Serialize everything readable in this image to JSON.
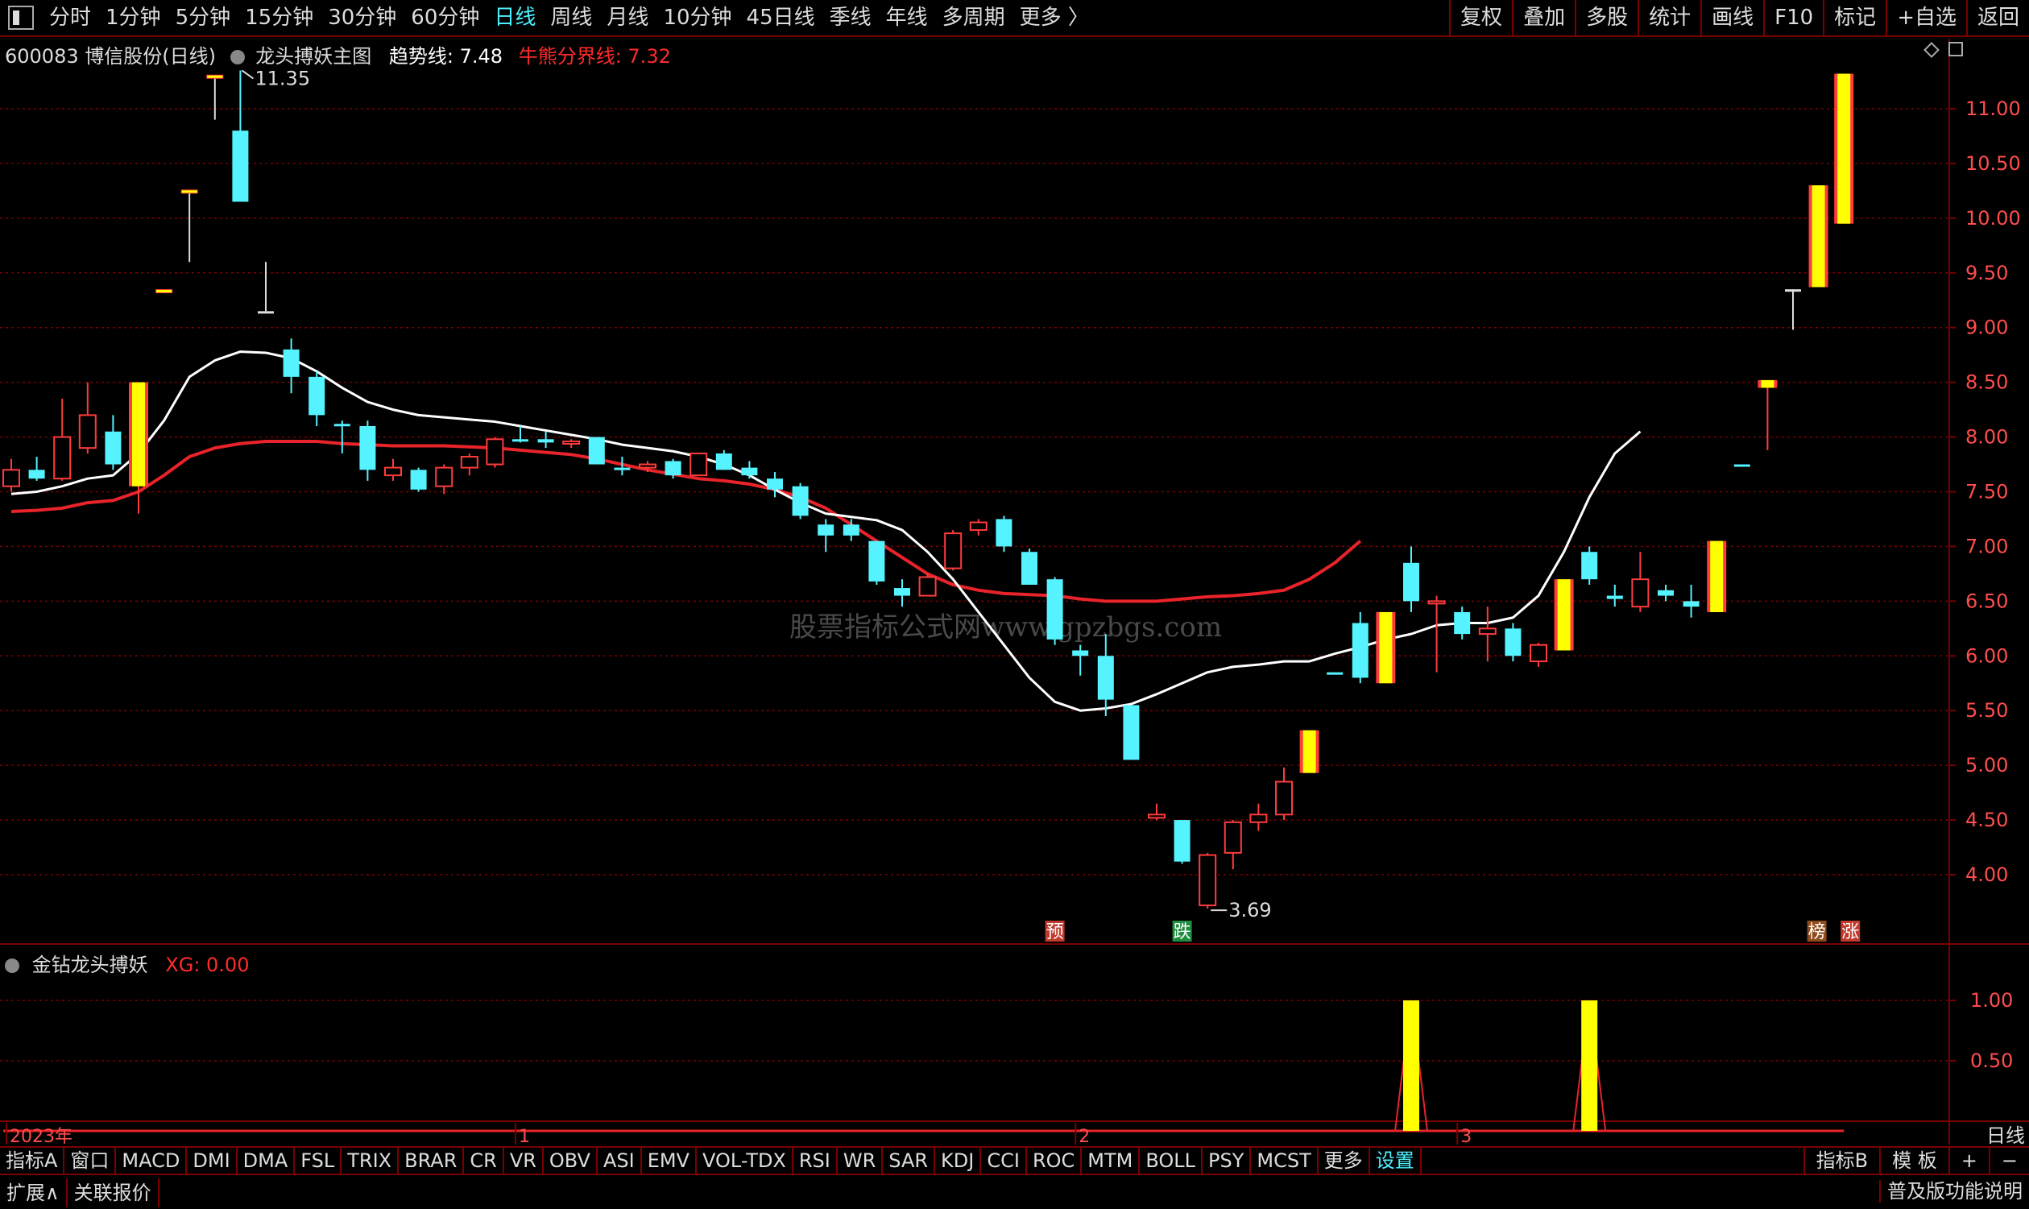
{
  "toolbar": {
    "timeframes": [
      "分时",
      "1分钟",
      "5分钟",
      "15分钟",
      "30分钟",
      "60分钟",
      "日线",
      "周线",
      "月线",
      "10分钟",
      "45日线",
      "季线",
      "年线",
      "多周期",
      "更多 〉"
    ],
    "active_timeframe": "日线",
    "right_buttons": [
      "复权",
      "叠加",
      "多股",
      "统计",
      "画线",
      "F10",
      "标记",
      "+自选",
      "返回"
    ]
  },
  "stock": {
    "code_name": "600083 博信股份(日线)",
    "indicator_title": "龙头搏妖主图",
    "trend_label": "趋势线: 7.48",
    "bull_label": "牛熊分界线: 7.32"
  },
  "sub_indicator": {
    "name": "金钻龙头搏妖",
    "xg_label": "XG: 0.00"
  },
  "watermark": "股票指标公式网www.gpzbgs.com",
  "annotations": {
    "high": "11.35",
    "low": "3.69",
    "yu": "预",
    "die": "跌",
    "bang": "榜",
    "zhang": "涨"
  },
  "x_axis": {
    "labels": [
      "2023年",
      "1",
      "2",
      "3"
    ],
    "period": "日线"
  },
  "main_chart": {
    "y_ticks": [
      "11.00",
      "10.50",
      "10.00",
      "9.50",
      "9.00",
      "8.50",
      "8.00",
      "7.50",
      "7.00",
      "6.50",
      "6.00",
      "5.50",
      "5.00",
      "4.50",
      "4.00"
    ],
    "y_tick_values": [
      11.0,
      10.5,
      10.0,
      9.5,
      9.0,
      8.5,
      8.0,
      7.5,
      7.0,
      6.5,
      6.0,
      5.5,
      5.0,
      4.5,
      4.0
    ],
    "candles": [
      {
        "o": 7.55,
        "h": 7.8,
        "l": 7.5,
        "c": 7.7,
        "k": "up"
      },
      {
        "o": 7.7,
        "h": 7.82,
        "l": 7.6,
        "c": 7.62,
        "k": "down"
      },
      {
        "o": 7.62,
        "h": 8.35,
        "l": 7.6,
        "c": 8.0,
        "k": "up"
      },
      {
        "o": 7.9,
        "h": 8.5,
        "l": 7.85,
        "c": 8.2,
        "k": "up"
      },
      {
        "o": 8.05,
        "h": 8.2,
        "l": 7.7,
        "c": 7.75,
        "k": "down"
      },
      {
        "o": 7.55,
        "h": 8.5,
        "l": 7.3,
        "c": 8.5,
        "k": "long"
      },
      {
        "o": 9.34,
        "h": 9.34,
        "l": 9.34,
        "c": 9.34,
        "k": "long_line"
      },
      {
        "o": 10.25,
        "h": 10.25,
        "l": 9.6,
        "c": 10.25,
        "k": "long_line"
      },
      {
        "o": 11.3,
        "h": 11.3,
        "l": 10.9,
        "c": 11.3,
        "k": "long_line"
      },
      {
        "o": 10.8,
        "h": 11.35,
        "l": 10.15,
        "c": 10.15,
        "k": "down"
      },
      {
        "o": 9.15,
        "h": 9.6,
        "l": 9.15,
        "c": 9.15,
        "k": "up_line"
      },
      {
        "o": 8.8,
        "h": 8.9,
        "l": 8.4,
        "c": 8.55,
        "k": "down"
      },
      {
        "o": 8.55,
        "h": 8.6,
        "l": 8.1,
        "c": 8.2,
        "k": "down"
      },
      {
        "o": 8.12,
        "h": 8.15,
        "l": 7.85,
        "c": 8.1,
        "k": "down"
      },
      {
        "o": 8.1,
        "h": 8.15,
        "l": 7.6,
        "c": 7.7,
        "k": "down"
      },
      {
        "o": 7.65,
        "h": 7.8,
        "l": 7.6,
        "c": 7.72,
        "k": "up"
      },
      {
        "o": 7.7,
        "h": 7.72,
        "l": 7.5,
        "c": 7.52,
        "k": "down"
      },
      {
        "o": 7.55,
        "h": 7.75,
        "l": 7.48,
        "c": 7.72,
        "k": "up"
      },
      {
        "o": 7.72,
        "h": 7.85,
        "l": 7.65,
        "c": 7.82,
        "k": "up"
      },
      {
        "o": 7.75,
        "h": 8.0,
        "l": 7.72,
        "c": 7.98,
        "k": "up"
      },
      {
        "o": 7.98,
        "h": 8.1,
        "l": 7.95,
        "c": 7.98,
        "k": "down"
      },
      {
        "o": 7.98,
        "h": 8.05,
        "l": 7.9,
        "c": 7.95,
        "k": "down"
      },
      {
        "o": 7.95,
        "h": 7.98,
        "l": 7.9,
        "c": 7.96,
        "k": "up"
      },
      {
        "o": 8.0,
        "h": 8.0,
        "l": 7.75,
        "c": 7.75,
        "k": "down"
      },
      {
        "o": 7.72,
        "h": 7.82,
        "l": 7.65,
        "c": 7.7,
        "k": "down"
      },
      {
        "o": 7.72,
        "h": 7.78,
        "l": 7.68,
        "c": 7.75,
        "k": "up"
      },
      {
        "o": 7.78,
        "h": 7.8,
        "l": 7.62,
        "c": 7.65,
        "k": "down"
      },
      {
        "o": 7.65,
        "h": 7.85,
        "l": 7.65,
        "c": 7.85,
        "k": "up"
      },
      {
        "o": 7.85,
        "h": 7.88,
        "l": 7.7,
        "c": 7.7,
        "k": "down"
      },
      {
        "o": 7.72,
        "h": 7.78,
        "l": 7.62,
        "c": 7.65,
        "k": "down"
      },
      {
        "o": 7.62,
        "h": 7.68,
        "l": 7.45,
        "c": 7.52,
        "k": "down"
      },
      {
        "o": 7.55,
        "h": 7.58,
        "l": 7.25,
        "c": 7.28,
        "k": "down"
      },
      {
        "o": 7.2,
        "h": 7.25,
        "l": 6.95,
        "c": 7.1,
        "k": "down"
      },
      {
        "o": 7.2,
        "h": 7.25,
        "l": 7.05,
        "c": 7.1,
        "k": "down"
      },
      {
        "o": 7.05,
        "h": 7.05,
        "l": 6.65,
        "c": 6.68,
        "k": "down"
      },
      {
        "o": 6.62,
        "h": 6.7,
        "l": 6.45,
        "c": 6.55,
        "k": "down"
      },
      {
        "o": 6.55,
        "h": 6.75,
        "l": 6.55,
        "c": 6.72,
        "k": "up"
      },
      {
        "o": 6.8,
        "h": 7.15,
        "l": 6.78,
        "c": 7.12,
        "k": "up"
      },
      {
        "o": 7.15,
        "h": 7.25,
        "l": 7.1,
        "c": 7.22,
        "k": "up"
      },
      {
        "o": 7.25,
        "h": 7.28,
        "l": 6.95,
        "c": 7.0,
        "k": "down"
      },
      {
        "o": 6.95,
        "h": 6.98,
        "l": 6.65,
        "c": 6.65,
        "k": "down"
      },
      {
        "o": 6.7,
        "h": 6.72,
        "l": 6.1,
        "c": 6.15,
        "k": "down"
      },
      {
        "o": 6.05,
        "h": 6.1,
        "l": 5.82,
        "c": 6.0,
        "k": "down"
      },
      {
        "o": 6.0,
        "h": 6.2,
        "l": 5.45,
        "c": 5.6,
        "k": "down"
      },
      {
        "o": 5.55,
        "h": 5.55,
        "l": 5.05,
        "c": 5.05,
        "k": "down"
      },
      {
        "o": 4.55,
        "h": 4.65,
        "l": 4.5,
        "c": 4.52,
        "k": "up"
      },
      {
        "o": 4.5,
        "h": 4.5,
        "l": 4.1,
        "c": 4.12,
        "k": "down"
      },
      {
        "o": 3.72,
        "h": 4.2,
        "l": 3.69,
        "c": 4.18,
        "k": "up"
      },
      {
        "o": 4.2,
        "h": 4.5,
        "l": 4.05,
        "c": 4.48,
        "k": "up"
      },
      {
        "o": 4.48,
        "h": 4.65,
        "l": 4.4,
        "c": 4.55,
        "k": "up"
      },
      {
        "o": 4.55,
        "h": 4.98,
        "l": 4.5,
        "c": 4.85,
        "k": "up"
      },
      {
        "o": 4.93,
        "h": 5.32,
        "l": 4.93,
        "c": 5.32,
        "k": "long"
      },
      {
        "o": 5.85,
        "h": 5.85,
        "l": 5.85,
        "c": 5.85,
        "k": "down_line"
      },
      {
        "o": 6.3,
        "h": 6.4,
        "l": 5.75,
        "c": 5.8,
        "k": "down"
      },
      {
        "o": 5.75,
        "h": 6.4,
        "l": 5.75,
        "c": 6.4,
        "k": "long"
      },
      {
        "o": 6.85,
        "h": 7.0,
        "l": 6.4,
        "c": 6.5,
        "k": "down"
      },
      {
        "o": 6.5,
        "h": 6.55,
        "l": 5.85,
        "c": 6.5,
        "k": "up"
      },
      {
        "o": 6.4,
        "h": 6.45,
        "l": 6.15,
        "c": 6.2,
        "k": "down"
      },
      {
        "o": 6.2,
        "h": 6.45,
        "l": 5.95,
        "c": 6.25,
        "k": "up"
      },
      {
        "o": 6.25,
        "h": 6.3,
        "l": 5.95,
        "c": 6.0,
        "k": "down"
      },
      {
        "o": 5.95,
        "h": 6.12,
        "l": 5.9,
        "c": 6.1,
        "k": "up"
      },
      {
        "o": 6.05,
        "h": 6.7,
        "l": 6.05,
        "c": 6.7,
        "k": "long"
      },
      {
        "o": 6.95,
        "h": 7.0,
        "l": 6.65,
        "c": 6.7,
        "k": "down"
      },
      {
        "o": 6.55,
        "h": 6.65,
        "l": 6.45,
        "c": 6.52,
        "k": "down"
      },
      {
        "o": 6.45,
        "h": 6.95,
        "l": 6.4,
        "c": 6.7,
        "k": "up"
      },
      {
        "o": 6.6,
        "h": 6.65,
        "l": 6.5,
        "c": 6.55,
        "k": "down"
      },
      {
        "o": 6.5,
        "h": 6.65,
        "l": 6.35,
        "c": 6.45,
        "k": "down"
      },
      {
        "o": 6.4,
        "h": 7.05,
        "l": 6.4,
        "c": 7.05,
        "k": "long"
      },
      {
        "o": 7.75,
        "h": 7.75,
        "l": 7.75,
        "c": 7.75,
        "k": "down_line"
      },
      {
        "o": 8.45,
        "h": 8.52,
        "l": 7.88,
        "c": 8.52,
        "k": "long"
      },
      {
        "o": 9.35,
        "h": 9.35,
        "l": 8.98,
        "c": 9.35,
        "k": "up_line"
      },
      {
        "o": 9.37,
        "h": 10.3,
        "l": 9.37,
        "c": 10.3,
        "k": "long"
      },
      {
        "o": 9.95,
        "h": 11.32,
        "l": 9.95,
        "c": 11.32,
        "k": "long"
      }
    ],
    "trend_line": [
      7.48,
      7.5,
      7.55,
      7.62,
      7.65,
      7.85,
      8.15,
      8.55,
      8.7,
      8.78,
      8.77,
      8.72,
      8.6,
      8.45,
      8.32,
      8.25,
      8.2,
      8.18,
      8.16,
      8.14,
      8.1,
      8.06,
      8.02,
      7.98,
      7.93,
      7.9,
      7.87,
      7.82,
      7.75,
      7.65,
      7.52,
      7.4,
      7.3,
      7.27,
      7.24,
      7.15,
      6.95,
      6.7,
      6.4,
      6.1,
      5.8,
      5.58,
      5.5,
      5.52,
      5.56,
      5.65,
      5.75,
      5.85,
      5.9,
      5.92,
      5.95,
      5.95,
      6.02,
      6.08,
      6.15,
      6.2,
      6.28,
      6.3,
      6.3,
      6.35,
      6.55,
      6.95,
      7.45,
      7.85,
      8.05
    ],
    "bull_line": [
      7.32,
      7.33,
      7.35,
      7.4,
      7.42,
      7.5,
      7.65,
      7.82,
      7.9,
      7.94,
      7.96,
      7.96,
      7.96,
      7.94,
      7.93,
      7.92,
      7.92,
      7.92,
      7.91,
      7.9,
      7.88,
      7.86,
      7.84,
      7.8,
      7.75,
      7.7,
      7.66,
      7.62,
      7.6,
      7.57,
      7.52,
      7.45,
      7.35,
      7.2,
      7.05,
      6.9,
      6.75,
      6.65,
      6.6,
      6.57,
      6.56,
      6.55,
      6.52,
      6.5,
      6.5,
      6.5,
      6.52,
      6.54,
      6.55,
      6.57,
      6.6,
      6.7,
      6.85,
      7.05
    ]
  },
  "sub_chart": {
    "y_ticks": [
      "1.00",
      "0.50"
    ],
    "y_tick_values": [
      1.0,
      0.5
    ],
    "signal_positions": [
      55,
      62
    ],
    "signal_value": 1.0
  },
  "indicator_tabs": [
    "指标A",
    "窗口",
    "MACD",
    "DMI",
    "DMA",
    "FSL",
    "TRIX",
    "BRAR",
    "CR",
    "VR",
    "OBV",
    "ASI",
    "EMV",
    "VOL-TDX",
    "RSI",
    "WR",
    "SAR",
    "KDJ",
    "CCI",
    "ROC",
    "MTM",
    "BOLL",
    "PSY",
    "MCST",
    "更多",
    "设置"
  ],
  "active_indicator_tab": "设置",
  "indicator_right": [
    "指标B",
    "模 板",
    "+",
    "−"
  ],
  "bottom": {
    "left": [
      "扩展∧",
      "关联报价"
    ],
    "right": "普及版功能说明"
  },
  "colors": {
    "up": "#ff3b3b",
    "down": "#54f3ff",
    "long": "#ffff00",
    "grid": "#7a0000",
    "trend": "#ffffff",
    "bull": "#e8232a",
    "axis_text": "#ff4d4d"
  }
}
